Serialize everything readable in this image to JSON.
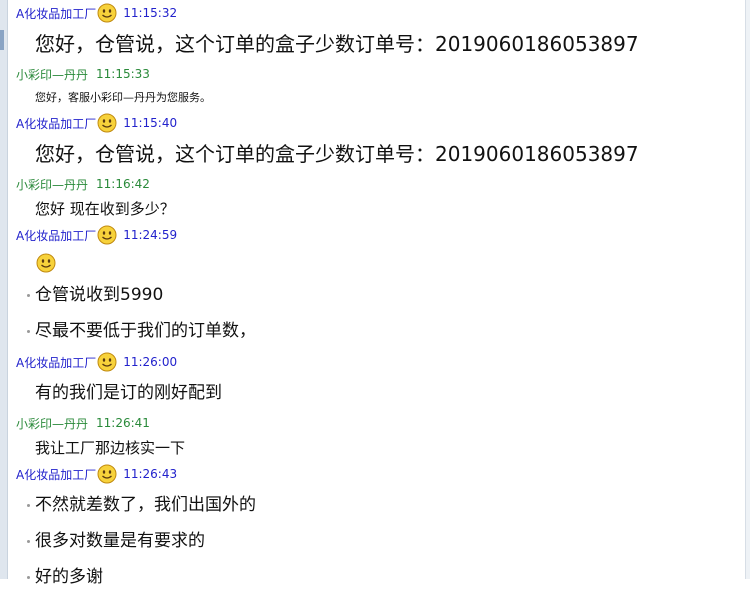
{
  "customer_name": "A化妆品加工厂",
  "staff_name": "小彩印—丹丹",
  "messages": [
    {
      "time": "11:15:32",
      "text": "您好，仓管说，这个订单的盒子少数订单号：2019060186053897"
    },
    {
      "time": "11:15:33",
      "text": "您好，客服小彩印—丹丹为您服务。"
    },
    {
      "time": "11:15:40",
      "text": "您好，仓管说，这个订单的盒子少数订单号：2019060186053897"
    },
    {
      "time": "11:16:42",
      "text": "您好  现在收到多少？"
    },
    {
      "time": "11:24:59",
      "lines": [
        "仓管说收到5990",
        "尽最不要低于我们的订单数，"
      ]
    },
    {
      "time": "11:26:00",
      "text": "有的我们是订的刚好配到"
    },
    {
      "time": "11:26:41",
      "text": "我让工厂那边核实一下"
    },
    {
      "time": "11:26:43",
      "lines": [
        "不然就差数了，我们出国外的",
        "很多对数量是有要求的",
        "好的多谢"
      ]
    }
  ],
  "icons": {
    "smiley": "smiley-emoji-icon"
  },
  "colors": {
    "customer": "#2222cc",
    "staff": "#2a8a3a"
  }
}
